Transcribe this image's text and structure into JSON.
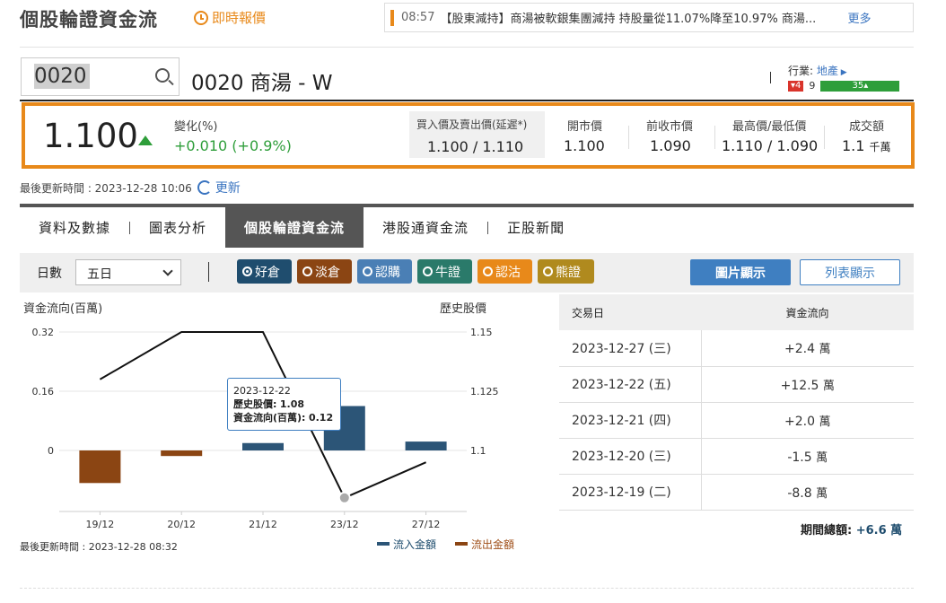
{
  "header": {
    "title": "個股輪證資金流",
    "realtime_label": "即時報價",
    "news_time": "08:57",
    "news_text": "【股東減持】商湯被軟銀集團減持 持股量從11.07%降至10.97% 商湯...",
    "news_more": "更多"
  },
  "search": {
    "value": "0020"
  },
  "stock": {
    "name": "0020 商湯 - W"
  },
  "industry": {
    "label": "行業:",
    "link": "地產",
    "down_count": "4",
    "flat_count": "9",
    "up_count": "35"
  },
  "quote": {
    "price": "1.100",
    "change_label": "變化(%)",
    "change_value": "+0.010 (+0.9%)",
    "bidask_label": "買入價及賣出價(延遲*)",
    "bidask_value": "1.100 / 1.110",
    "open_label": "開市價",
    "open_value": "1.100",
    "prev_label": "前收市價",
    "prev_value": "1.090",
    "hilo_label": "最高價/最低價",
    "hilo_value": "1.110 / 1.090",
    "turnover_label": "成交額",
    "turnover_value": "1.1",
    "turnover_unit": "千萬"
  },
  "last_update": {
    "text": "最後更新時間 : 2023-12-28 10:06",
    "refresh": "更新"
  },
  "tabs": [
    "資料及數據",
    "圖表分析",
    "個股輪證資金流",
    "港股通資金流",
    "正股新聞"
  ],
  "filters": {
    "days_label": "日數",
    "days_value": "五日",
    "pills": [
      {
        "label": "好倉",
        "color": "#1f4d6e",
        "checked": true
      },
      {
        "label": "淡倉",
        "color": "#8b4513",
        "checked": false
      },
      {
        "label": "認購",
        "color": "#4a7fb5",
        "checked": false
      },
      {
        "label": "牛證",
        "color": "#2a7a6a",
        "checked": false
      },
      {
        "label": "認沽",
        "color": "#e8891a",
        "checked": false
      },
      {
        "label": "熊證",
        "color": "#b08a1e",
        "checked": false
      }
    ],
    "chart_btn": "圖片顯示",
    "list_btn": "列表顯示"
  },
  "chart_data": {
    "type": "bar+line",
    "left_axis_label": "資金流向(百萬)",
    "right_axis_label": "歷史股價",
    "categories": [
      "19/12",
      "20/12",
      "21/12",
      "22/12",
      "27/12"
    ],
    "x_tick_labels": [
      "19/12",
      "20/12",
      "21/12",
      "23/12",
      "27/12"
    ],
    "flow_values": [
      -0.088,
      -0.015,
      0.02,
      0.12,
      0.024
    ],
    "price_values": [
      1.13,
      1.15,
      1.15,
      1.08,
      1.095
    ],
    "left_ticks": [
      "0.32",
      "0.16",
      "0"
    ],
    "right_ticks": [
      "1.15",
      "1.125",
      "1.1"
    ],
    "left_ylim": [
      -0.32,
      0.32
    ],
    "right_ylim": [
      1.075,
      1.15
    ],
    "legend": [
      "流入金額",
      "流出金額"
    ],
    "colors": {
      "inflow": "#2c5577",
      "outflow": "#8b4513",
      "line": "#111111"
    },
    "tooltip": {
      "date": "2023-12-22",
      "price_label": "歷史股價:",
      "price_value": "1.08",
      "flow_label": "資金流向(百萬):",
      "flow_value": "0.12"
    },
    "update_text": "最後更新時間 : 2023-12-28 08:32"
  },
  "table": {
    "headers": [
      "交易日",
      "資金流向"
    ],
    "rows": [
      {
        "date": "2023-12-27 (三)",
        "value": "+2.4",
        "unit": "萬",
        "sign": "pos"
      },
      {
        "date": "2023-12-22 (五)",
        "value": "+12.5",
        "unit": "萬",
        "sign": "pos"
      },
      {
        "date": "2023-12-21 (四)",
        "value": "+2.0",
        "unit": "萬",
        "sign": "pos"
      },
      {
        "date": "2023-12-20 (三)",
        "value": "-1.5",
        "unit": "萬",
        "sign": "neg"
      },
      {
        "date": "2023-12-19 (二)",
        "value": "-8.8",
        "unit": "萬",
        "sign": "neg"
      }
    ],
    "total_label": "期間總額:",
    "total_value": "+6.6 萬"
  }
}
